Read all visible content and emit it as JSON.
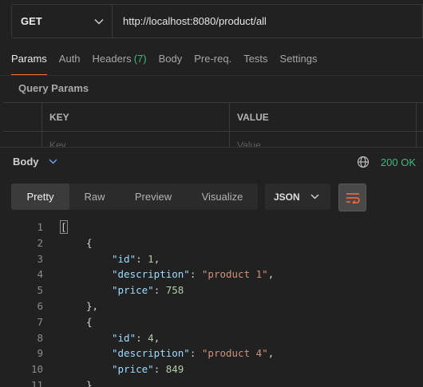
{
  "request": {
    "method": "GET",
    "url": "http://localhost:8080/product/all"
  },
  "tabs": [
    {
      "label": "Params",
      "active": true
    },
    {
      "label": "Auth"
    },
    {
      "label": "Headers",
      "count": "(7)"
    },
    {
      "label": "Body"
    },
    {
      "label": "Pre-req."
    },
    {
      "label": "Tests"
    },
    {
      "label": "Settings"
    }
  ],
  "query_params": {
    "title": "Query Params",
    "key_header": "KEY",
    "value_header": "VALUE",
    "key_placeholder": "Key",
    "value_placeholder": "Value"
  },
  "response": {
    "title": "Body",
    "status": "200 OK",
    "format_tabs": [
      "Pretty",
      "Raw",
      "Preview",
      "Visualize"
    ],
    "active_format": "Pretty",
    "language": "JSON"
  },
  "code_lines": [
    {
      "n": "1",
      "indent": 0,
      "tokens": [
        [
          "p",
          "["
        ]
      ]
    },
    {
      "n": "2",
      "indent": 1,
      "tokens": [
        [
          "p",
          "{"
        ]
      ]
    },
    {
      "n": "3",
      "indent": 2,
      "tokens": [
        [
          "k",
          "\"id\""
        ],
        [
          "p",
          ": "
        ],
        [
          "n",
          "1"
        ],
        [
          "p",
          ","
        ]
      ]
    },
    {
      "n": "4",
      "indent": 2,
      "tokens": [
        [
          "k",
          "\"description\""
        ],
        [
          "p",
          ": "
        ],
        [
          "s",
          "\"product 1\""
        ],
        [
          "p",
          ","
        ]
      ]
    },
    {
      "n": "5",
      "indent": 2,
      "tokens": [
        [
          "k",
          "\"price\""
        ],
        [
          "p",
          ": "
        ],
        [
          "n",
          "758"
        ]
      ]
    },
    {
      "n": "6",
      "indent": 1,
      "tokens": [
        [
          "p",
          "},"
        ]
      ]
    },
    {
      "n": "7",
      "indent": 1,
      "tokens": [
        [
          "p",
          "{"
        ]
      ]
    },
    {
      "n": "8",
      "indent": 2,
      "tokens": [
        [
          "k",
          "\"id\""
        ],
        [
          "p",
          ": "
        ],
        [
          "n",
          "4"
        ],
        [
          "p",
          ","
        ]
      ]
    },
    {
      "n": "9",
      "indent": 2,
      "tokens": [
        [
          "k",
          "\"description\""
        ],
        [
          "p",
          ": "
        ],
        [
          "s",
          "\"product 4\""
        ],
        [
          "p",
          ","
        ]
      ]
    },
    {
      "n": "10",
      "indent": 2,
      "tokens": [
        [
          "k",
          "\"price\""
        ],
        [
          "p",
          ": "
        ],
        [
          "n",
          "849"
        ]
      ]
    },
    {
      "n": "11",
      "indent": 1,
      "tokens": [
        [
          "p",
          "}"
        ]
      ]
    }
  ],
  "colors": {
    "accent": "#ff6c37",
    "status_ok": "#3fb980"
  }
}
